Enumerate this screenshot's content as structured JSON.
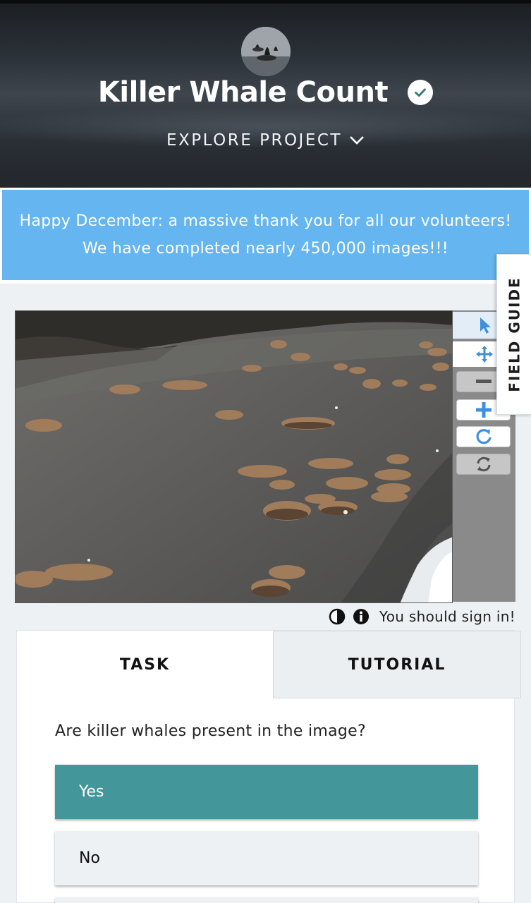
{
  "header": {
    "project_title": "Killer Whale Count",
    "explore_label": "EXPLORE PROJECT"
  },
  "announcement": {
    "text": "Happy December: a massive thank you for all our volunteers! We have completed nearly 450,000 images!!!"
  },
  "field_guide": {
    "label": "FIELD GUIDE"
  },
  "viewer": {
    "tools": [
      "pointer-icon",
      "move-icon",
      "zoom-out-icon",
      "zoom-in-icon",
      "rotate-icon",
      "reset-icon"
    ],
    "sign_in_notice": "You should sign in!"
  },
  "tabs": {
    "task": "TASK",
    "tutorial": "TUTORIAL"
  },
  "task": {
    "question": "Are killer whales present in the image?",
    "answers": [
      "Yes",
      "No"
    ]
  },
  "colors": {
    "accent_blue": "#3d8fe0",
    "announcement_bg": "#64b5f0",
    "answer_selected": "#43979b"
  }
}
